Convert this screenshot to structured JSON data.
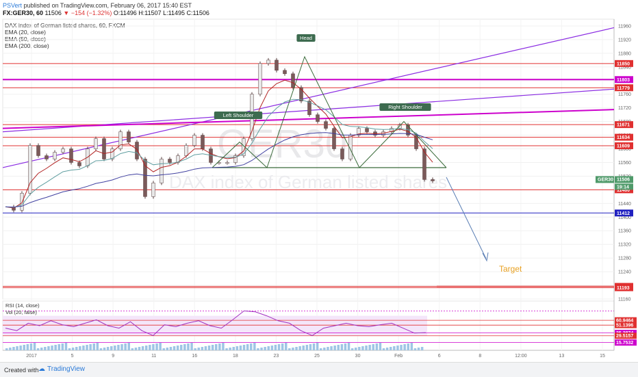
{
  "header": {
    "user": "PSVert",
    "published": "published on TradingView.com, February 06, 2017 15:40 EST",
    "symbol": "FX:GER30, 60",
    "last": "11506",
    "change": "▼ −154 (−1.32%)",
    "ohlc": "O:11496 H:11507 L:11495 C:11506"
  },
  "legend": {
    "title": "DAX index of German listed shares, 60, FXCM",
    "ema20": "EMA (20, close)",
    "ema50": "EMA (50, close)",
    "ema200": "EMA (200, close)"
  },
  "watermark": {
    "symbol": "GER30",
    "name": "DAX index of German listed shares"
  },
  "footer": {
    "created_with": "Created with",
    "brand": "TradingView"
  },
  "colors": {
    "up": "#2e8b57",
    "down": "#b22222",
    "body": "#7b5a5a",
    "red_level": "#e03030",
    "magenta": "#cc00cc",
    "purple": "#8a2be2",
    "ema20": "#b22222",
    "ema50": "#5f9ea0",
    "ema200": "#4040a0",
    "rsi": "#a030c0",
    "volume": "#9ec5e5"
  },
  "chart_data": {
    "type": "line",
    "title": "DAX index of German listed shares, 60, FXCM",
    "y_range": [
      11160,
      11980
    ],
    "y_ticks": [
      11960,
      11920,
      11880,
      11840,
      11800,
      11760,
      11720,
      11680,
      11640,
      11600,
      11560,
      11520,
      11480,
      11440,
      11400,
      11360,
      11320,
      11280,
      11240,
      11200,
      11160
    ],
    "x_ticks": [
      "2017",
      "5",
      "9",
      "11",
      "16",
      "18",
      "23",
      "25",
      "30",
      "Feb",
      "6",
      "8",
      "12:00",
      "13",
      "15"
    ],
    "price_path": [
      11430,
      11420,
      11470,
      11610,
      11580,
      11570,
      11590,
      11600,
      11560,
      11550,
      11600,
      11630,
      11570,
      11600,
      11650,
      11620,
      11570,
      11460,
      11500,
      11570,
      11560,
      11580,
      11610,
      11640,
      11600,
      11560,
      11560,
      11560,
      11580,
      11630,
      11760,
      11850,
      11860,
      11830,
      11820,
      11780,
      11740,
      11700,
      11680,
      11660,
      11600,
      11570,
      11640,
      11660,
      11650,
      11640,
      11650,
      11660,
      11670,
      11640,
      11600,
      11510,
      11506
    ],
    "horizontal_levels": [
      {
        "value": 11850,
        "label": "11850",
        "color": "#e03030"
      },
      {
        "value": 11803,
        "label": "11803",
        "color": "#cc00cc"
      },
      {
        "value": 11779,
        "label": "11779",
        "color": "#e03030"
      },
      {
        "value": 11671,
        "label": "11671",
        "color": "#e03030"
      },
      {
        "value": 11634,
        "label": "11634",
        "color": "#e03030"
      },
      {
        "value": 11609,
        "label": "11609",
        "color": "#e03030"
      },
      {
        "value": 11480,
        "label": "11480",
        "color": "#e03030"
      },
      {
        "value": 11412,
        "label": "11412",
        "color": "#2020c0"
      },
      {
        "value": 11197,
        "label": "11197",
        "color": "#e03030"
      },
      {
        "value": 11193,
        "label": "11193",
        "color": "#e03030"
      }
    ],
    "current_price": {
      "symbol": "GER30",
      "value": 11506,
      "label": "11506",
      "countdown": "19:14"
    },
    "annotations": {
      "head": "Head",
      "left_shoulder": "Left Shoulder",
      "right_shoulder": "Right Shoulder",
      "target": "Target"
    },
    "rsi": {
      "name": "RSI (14, close)",
      "volume_name": "Vol (20, false)",
      "levels": [
        "80.0000",
        "60.9464",
        "51.1396",
        "35.3874",
        "29.5157",
        "15.7532"
      ],
      "path": [
        45,
        40,
        55,
        50,
        60,
        52,
        48,
        55,
        62,
        50,
        45,
        58,
        40,
        30,
        52,
        48,
        55,
        60,
        50,
        45,
        62,
        80,
        78,
        70,
        60,
        55,
        40,
        30,
        45,
        50,
        55,
        50,
        48,
        52,
        55,
        45,
        35,
        36
      ]
    }
  }
}
